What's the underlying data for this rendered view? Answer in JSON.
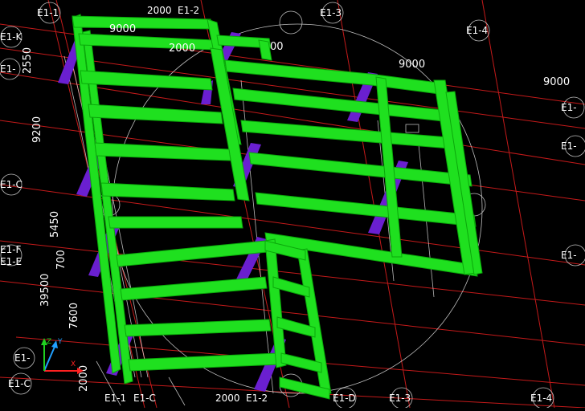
{
  "colors": {
    "background": "#000000",
    "grid_red": "#c41a1a",
    "grid_white": "#d8d8d8",
    "beam_green": "#1fe01f",
    "beam_green_dark": "#0aa80a",
    "support_purple": "#6a1fd0",
    "support_purple_dark": "#3f0e8c",
    "axis_circle": "#bfbfbf",
    "label_text": "#ffffff",
    "ucs_x": "#ff2020",
    "ucs_y": "#20a0ff",
    "ucs_z": "#20d020"
  },
  "grid_bubbles": [
    {
      "label": "E1-1"
    },
    {
      "label": "2000"
    },
    {
      "label": "E1-2"
    },
    {
      "label": "E1-3"
    },
    {
      "label": "E1-4"
    },
    {
      "label": "E1-K"
    },
    {
      "label": "E1-"
    },
    {
      "label": "E1-C"
    },
    {
      "label": "E1-F"
    },
    {
      "label": "E1-E"
    },
    {
      "label": "E1-"
    },
    {
      "label": "E1-C"
    },
    {
      "label": "E1-1"
    },
    {
      "label": "E1-C"
    },
    {
      "label": "2000"
    },
    {
      "label": "E1-2"
    },
    {
      "label": "E1-D"
    },
    {
      "label": "E1-3"
    },
    {
      "label": "E1-4"
    },
    {
      "label": "E1-"
    },
    {
      "label": "E1-"
    },
    {
      "label": "E1-"
    }
  ],
  "dimensions": [
    {
      "text": "9000"
    },
    {
      "text": "2000"
    },
    {
      "text": "00"
    },
    {
      "text": "9000"
    },
    {
      "text": "9000"
    },
    {
      "text": "2550"
    },
    {
      "text": "9200"
    },
    {
      "text": "5450"
    },
    {
      "text": "700"
    },
    {
      "text": "39500"
    },
    {
      "text": "7600"
    },
    {
      "text": "2000"
    }
  ],
  "ucs": {
    "x_label": "X",
    "y_label": "Y",
    "z_label": "Z"
  }
}
